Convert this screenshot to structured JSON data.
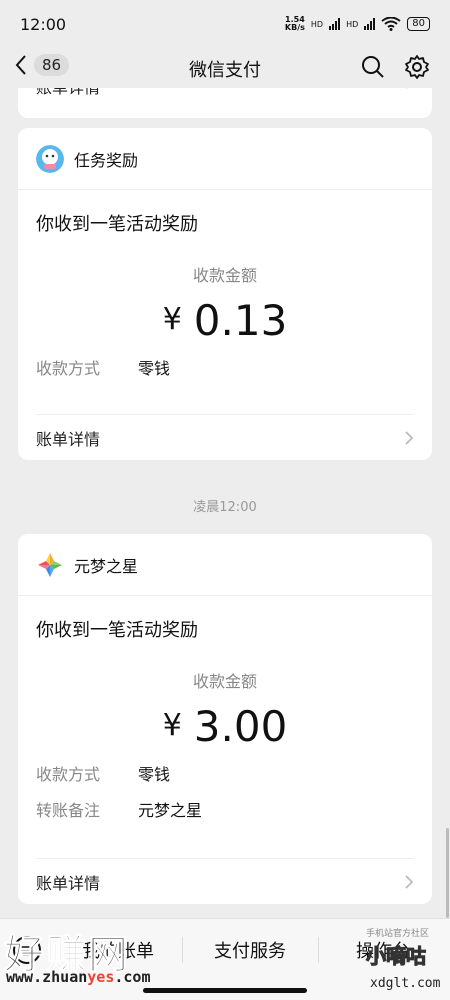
{
  "status_bar": {
    "time": "12:00",
    "net_speed_value": "1.54",
    "net_speed_unit": "KB/s",
    "hd1": "HD",
    "hd2": "HD",
    "battery": "80"
  },
  "header": {
    "unread_count": "86",
    "title": "微信支付"
  },
  "top_card": {
    "detail_label": "账单详情"
  },
  "cards": [
    {
      "app_name": "任务奖励",
      "message": "你收到一笔活动奖励",
      "amount_label": "收款金额",
      "currency": "¥",
      "amount": "0.13",
      "fields": [
        {
          "key": "收款方式",
          "value": "零钱"
        }
      ],
      "detail_label": "账单详情"
    },
    {
      "app_name": "元梦之星",
      "message": "你收到一笔活动奖励",
      "amount_label": "收款金额",
      "currency": "¥",
      "amount": "3.00",
      "fields": [
        {
          "key": "收款方式",
          "value": "零钱"
        },
        {
          "key": "转账备注",
          "value": "元梦之星"
        }
      ],
      "detail_label": "账单详情"
    }
  ],
  "timestamp": "凌晨12:00",
  "bottom_bar": {
    "items": [
      "我的账单",
      "支付服务",
      "操作台"
    ]
  },
  "watermarks": {
    "left_text": "好赚网",
    "left_url_pre": "www.zhuan",
    "left_url_hl": "yes",
    "left_url_post": ".com",
    "right_small": "手机站官方社区",
    "right_text": "小嘀咕",
    "right_url": "xdglt.com"
  },
  "colors": {
    "background": "#ededed",
    "card": "#ffffff",
    "secondary_text": "#888888"
  }
}
